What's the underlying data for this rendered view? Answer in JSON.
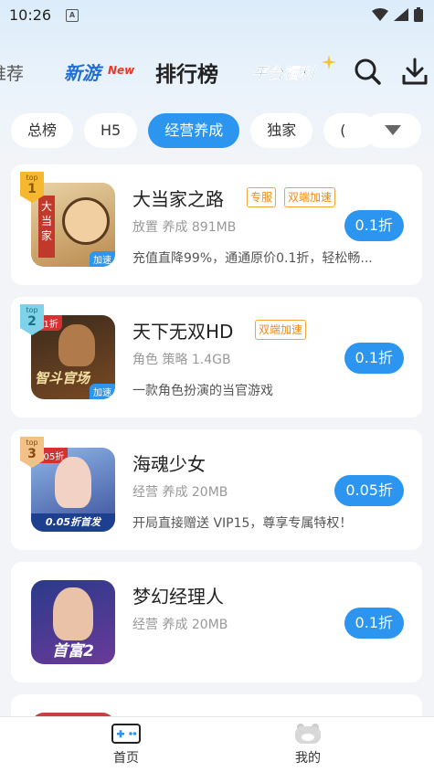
{
  "status_bar": {
    "time": "10:26",
    "sim_label": "A"
  },
  "top_nav": {
    "recommend": "推荐",
    "new_games_logo": "新游",
    "new_badge": "New",
    "ranking": "排行榜",
    "welfare_logo": "平台福利"
  },
  "categories": {
    "items": [
      "总榜",
      "H5",
      "经营养成",
      "独家",
      "("
    ],
    "selected": "经营养成"
  },
  "games": [
    {
      "rank_label": "top",
      "rank": "1",
      "title": "大当家之路",
      "tags": [
        "专服",
        "双端加速"
      ],
      "meta": "放置 养成 891MB",
      "description": "充值直降99%，通通原价0.1折，轻松畅...",
      "discount": "0.1折",
      "cover_text": "大当家",
      "cover_badge": "加速"
    },
    {
      "rank_label": "top",
      "rank": "2",
      "title": "天下无双HD",
      "tags": [
        "双端加速"
      ],
      "meta": "角色 策略 1.4GB",
      "description": "一款角色扮演的当官游戏",
      "discount": "0.1折",
      "cover_text": "智斗官场",
      "cover_badge": "加速",
      "cover_corner": "0.1折"
    },
    {
      "rank_label": "top",
      "rank": "3",
      "title": "海魂少女",
      "tags": [],
      "meta": "经营 养成 20MB",
      "description": "开局直接赠送 VIP15，尊享专属特权！",
      "discount": "0.05折",
      "cover_text": "0.05折首发",
      "cover_corner": "0.05折"
    },
    {
      "title": "梦幻经理人",
      "tags": [],
      "meta": "经营 养成 20MB",
      "description": "",
      "discount": "0.1折",
      "cover_text": "首富2"
    }
  ],
  "tab_bar": {
    "home": "首页",
    "mine": "我的"
  },
  "colors": {
    "accent": "#2b95f0",
    "tag_orange": "#f08b1a",
    "rank_gold": "#f5b82e"
  }
}
